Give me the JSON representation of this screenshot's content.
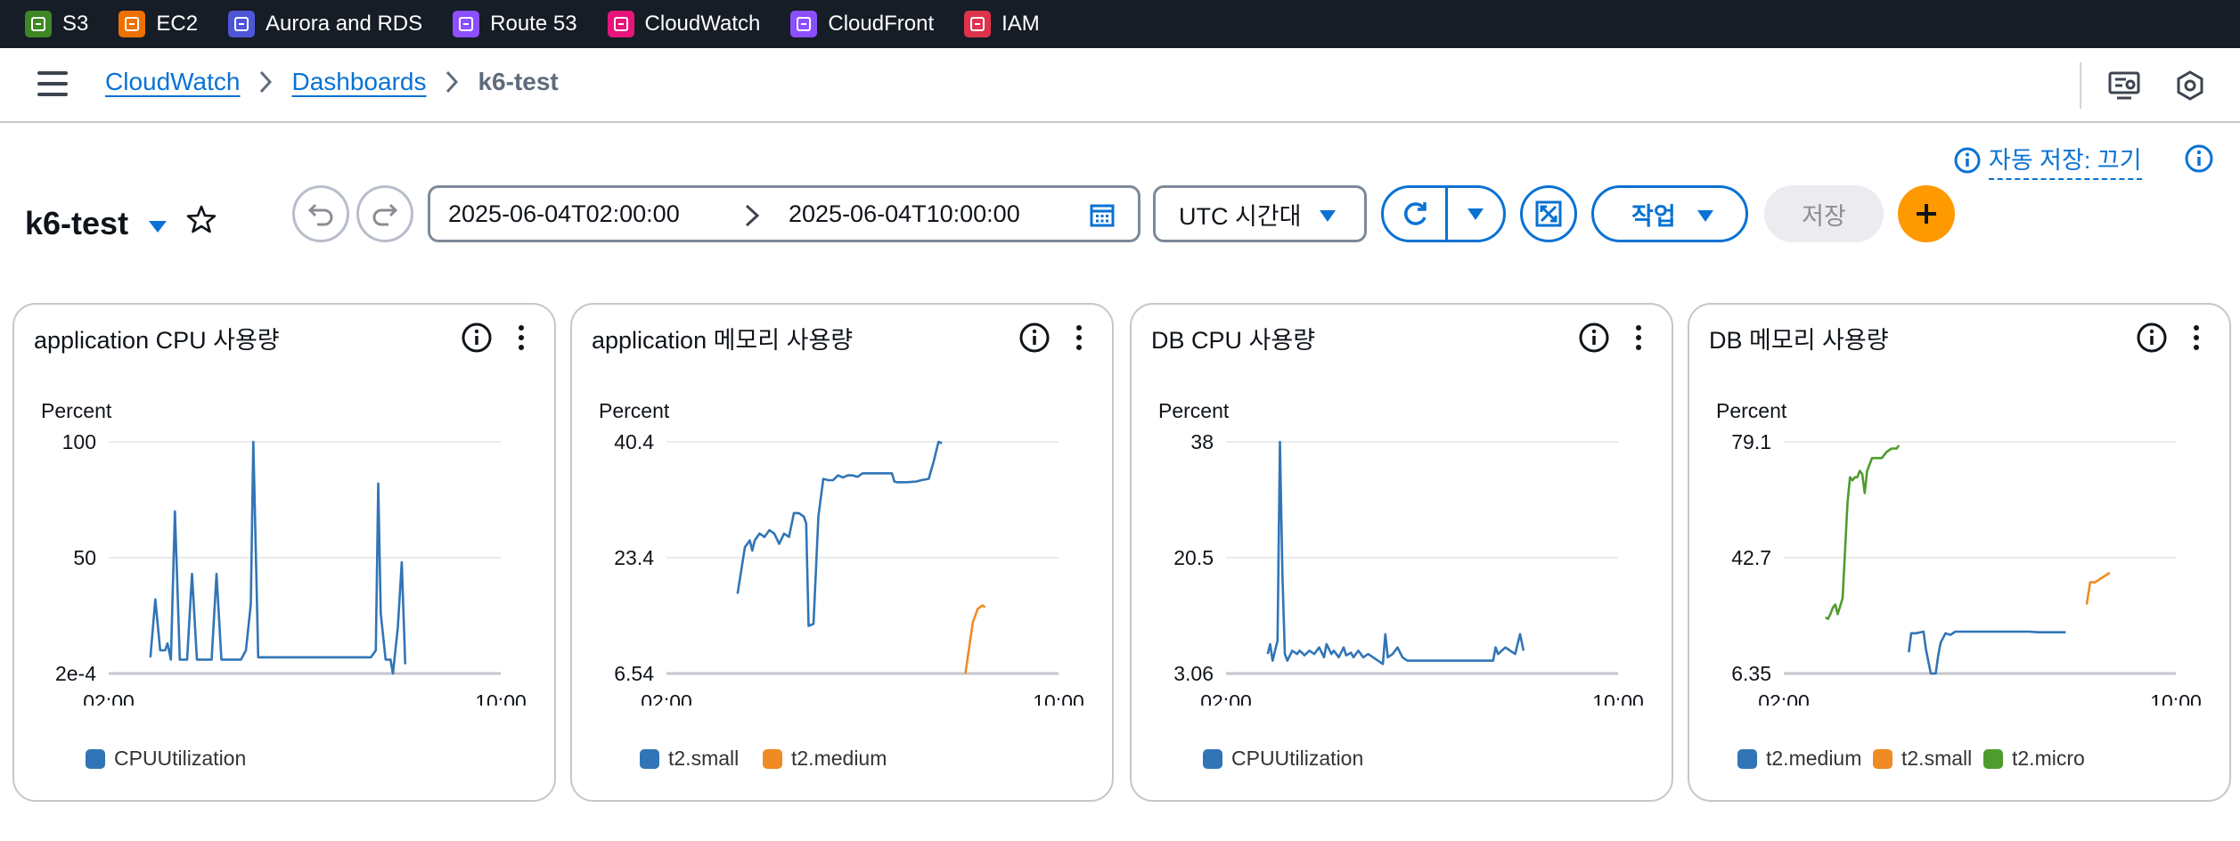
{
  "services": [
    {
      "label": "S3",
      "color": "#3f8624",
      "icon": "s3-icon"
    },
    {
      "label": "EC2",
      "color": "#ed7100",
      "icon": "ec2-icon"
    },
    {
      "label": "Aurora and RDS",
      "color": "#4d56d8",
      "icon": "rds-icon"
    },
    {
      "label": "Route 53",
      "color": "#8c4fff",
      "icon": "route53-icon"
    },
    {
      "label": "CloudWatch",
      "color": "#e7157b",
      "icon": "cloudwatch-icon"
    },
    {
      "label": "CloudFront",
      "color": "#8c4fff",
      "icon": "cloudfront-icon"
    },
    {
      "label": "IAM",
      "color": "#dd344c",
      "icon": "iam-icon"
    }
  ],
  "breadcrumb": {
    "root": "CloudWatch",
    "middle": "Dashboards",
    "current": "k6-test"
  },
  "autosave": {
    "label": "자동 저장: 끄기"
  },
  "dashboard": {
    "title": "k6-test",
    "start": "2025-06-04T02:00:00",
    "end": "2025-06-04T10:00:00",
    "timezone": "UTC 시간대",
    "actions_label": "작업",
    "save_label": "저장"
  },
  "colors": {
    "blue": "#3175b6",
    "orange": "#f08a24",
    "green": "#4e9c2e",
    "accent": "#0972d3"
  },
  "widgets": [
    {
      "title": "application CPU 사용량",
      "unit": "Percent",
      "chart_data": {
        "type": "line",
        "xlim": [
          "02:00",
          "10:00"
        ],
        "ylim": [
          0.0002,
          100
        ],
        "yticks": [
          "100",
          "50",
          "2e-4"
        ],
        "xticks": [
          "02:00",
          "10:00"
        ],
        "series": [
          {
            "name": "CPUUtilization",
            "color": "#3175b6",
            "points": [
              [
                0.85,
                7
              ],
              [
                0.95,
                32
              ],
              [
                1.05,
                10
              ],
              [
                1.15,
                10
              ],
              [
                1.2,
                13
              ],
              [
                1.27,
                6
              ],
              [
                1.35,
                70
              ],
              [
                1.45,
                6
              ],
              [
                1.5,
                6
              ],
              [
                1.6,
                6
              ],
              [
                1.7,
                43
              ],
              [
                1.8,
                6
              ],
              [
                1.9,
                6
              ],
              [
                2.0,
                6
              ],
              [
                2.1,
                6
              ],
              [
                2.2,
                43
              ],
              [
                2.3,
                6
              ],
              [
                2.5,
                6
              ],
              [
                2.7,
                6
              ],
              [
                2.8,
                10
              ],
              [
                2.9,
                30
              ],
              [
                2.95,
                100
              ],
              [
                3.05,
                7
              ],
              [
                3.1,
                7
              ],
              [
                3.5,
                7
              ],
              [
                4.0,
                7
              ],
              [
                4.5,
                7
              ],
              [
                5.0,
                7
              ],
              [
                5.35,
                7
              ],
              [
                5.45,
                10
              ],
              [
                5.5,
                82
              ],
              [
                5.55,
                26
              ],
              [
                5.65,
                6
              ],
              [
                5.75,
                6
              ],
              [
                5.8,
                0
              ],
              [
                5.9,
                20
              ],
              [
                5.98,
                48
              ],
              [
                6.05,
                4
              ]
            ]
          }
        ]
      }
    },
    {
      "title": "application 메모리 사용량",
      "unit": "Percent",
      "chart_data": {
        "type": "line",
        "xlim": [
          "02:00",
          "10:00"
        ],
        "ylim": [
          6.54,
          40.4
        ],
        "yticks": [
          "40.4",
          "23.4",
          "6.54"
        ],
        "xticks": [
          "02:00",
          "10:00"
        ],
        "series": [
          {
            "name": "t2.small",
            "color": "#3175b6",
            "points": [
              [
                1.45,
                18.2
              ],
              [
                1.6,
                25
              ],
              [
                1.7,
                26
              ],
              [
                1.75,
                24.5
              ],
              [
                1.8,
                26
              ],
              [
                1.9,
                27
              ],
              [
                2.0,
                26.5
              ],
              [
                2.1,
                27.5
              ],
              [
                2.2,
                27
              ],
              [
                2.3,
                25.5
              ],
              [
                2.4,
                27
              ],
              [
                2.5,
                26.5
              ],
              [
                2.6,
                30
              ],
              [
                2.7,
                30
              ],
              [
                2.8,
                29.5
              ],
              [
                2.85,
                28.5
              ],
              [
                2.9,
                13.5
              ],
              [
                3.0,
                13.8
              ],
              [
                3.1,
                29.5
              ],
              [
                3.2,
                35
              ],
              [
                3.3,
                34.8
              ],
              [
                3.4,
                34.8
              ],
              [
                3.5,
                35.5
              ],
              [
                3.6,
                35.2
              ],
              [
                3.7,
                35.5
              ],
              [
                3.8,
                35.5
              ],
              [
                3.9,
                35.3
              ],
              [
                4.0,
                35.8
              ],
              [
                4.1,
                35.8
              ],
              [
                4.2,
                35.8
              ],
              [
                4.3,
                35.8
              ],
              [
                4.4,
                35.8
              ],
              [
                4.5,
                35.8
              ],
              [
                4.6,
                35.8
              ],
              [
                4.65,
                34.6
              ],
              [
                4.7,
                34.5
              ],
              [
                4.9,
                34.5
              ],
              [
                5.1,
                34.6
              ],
              [
                5.2,
                34.8
              ],
              [
                5.35,
                35
              ],
              [
                5.45,
                37.5
              ],
              [
                5.55,
                40.4
              ],
              [
                5.62,
                40.2
              ]
            ]
          },
          {
            "name": "t2.medium",
            "color": "#f08a24",
            "points": [
              [
                6.1,
                6.54
              ],
              [
                6.25,
                14
              ],
              [
                6.35,
                16
              ],
              [
                6.45,
                16.5
              ],
              [
                6.5,
                16.2
              ]
            ]
          }
        ]
      }
    },
    {
      "title": "DB CPU 사용량",
      "unit": "Percent",
      "chart_data": {
        "type": "line",
        "xlim": [
          "02:00",
          "10:00"
        ],
        "ylim": [
          3.06,
          38
        ],
        "yticks": [
          "38",
          "20.5",
          "3.06"
        ],
        "xticks": [
          "02:00",
          "10:00"
        ],
        "series": [
          {
            "name": "CPUUtilization",
            "color": "#3175b6",
            "points": [
              [
                0.85,
                6
              ],
              [
                0.9,
                7.5
              ],
              [
                0.95,
                5
              ],
              [
                1.0,
                6.5
              ],
              [
                1.05,
                8
              ],
              [
                1.1,
                38
              ],
              [
                1.15,
                18
              ],
              [
                1.2,
                6
              ],
              [
                1.25,
                5
              ],
              [
                1.35,
                6.5
              ],
              [
                1.45,
                6
              ],
              [
                1.5,
                6.5
              ],
              [
                1.55,
                6.2
              ],
              [
                1.6,
                5.8
              ],
              [
                1.7,
                6.5
              ],
              [
                1.8,
                6
              ],
              [
                1.9,
                7
              ],
              [
                2.0,
                5.5
              ],
              [
                2.05,
                7.5
              ],
              [
                2.15,
                6
              ],
              [
                2.2,
                6.5
              ],
              [
                2.3,
                5.5
              ],
              [
                2.4,
                7
              ],
              [
                2.45,
                5.8
              ],
              [
                2.55,
                6.2
              ],
              [
                2.6,
                5.5
              ],
              [
                2.7,
                6.5
              ],
              [
                2.8,
                5.5
              ],
              [
                2.9,
                6
              ],
              [
                3.0,
                5.5
              ],
              [
                3.1,
                5
              ],
              [
                3.2,
                4.5
              ],
              [
                3.25,
                9
              ],
              [
                3.3,
                5.5
              ],
              [
                3.4,
                6
              ],
              [
                3.5,
                7
              ],
              [
                3.6,
                5.5
              ],
              [
                3.7,
                5
              ],
              [
                3.8,
                5
              ],
              [
                4.0,
                5
              ],
              [
                4.5,
                5
              ],
              [
                5.0,
                5
              ],
              [
                5.3,
                5
              ],
              [
                5.45,
                5
              ],
              [
                5.5,
                7
              ],
              [
                5.55,
                6
              ],
              [
                5.7,
                7
              ],
              [
                5.8,
                6.5
              ],
              [
                5.9,
                6
              ],
              [
                6.0,
                9
              ],
              [
                6.07,
                6.5
              ]
            ]
          }
        ]
      }
    },
    {
      "title": "DB 메모리 사용량",
      "unit": "Percent",
      "chart_data": {
        "type": "line",
        "xlim": [
          "02:00",
          "10:00"
        ],
        "ylim": [
          6.35,
          79.1
        ],
        "yticks": [
          "79.1",
          "42.7",
          "6.35"
        ],
        "xticks": [
          "02:00",
          "10:00"
        ],
        "series": [
          {
            "name": "t2.medium",
            "color": "#3175b6",
            "points": [
              [
                2.55,
                13
              ],
              [
                2.6,
                19
              ],
              [
                2.7,
                19
              ],
              [
                2.85,
                19.5
              ],
              [
                2.9,
                14
              ],
              [
                3.0,
                6.35
              ],
              [
                3.1,
                6.35
              ],
              [
                3.15,
                12
              ],
              [
                3.2,
                16
              ],
              [
                3.3,
                19
              ],
              [
                3.4,
                18.5
              ],
              [
                3.5,
                19.5
              ],
              [
                3.6,
                19.5
              ],
              [
                3.8,
                19.5
              ],
              [
                4.0,
                19.5
              ],
              [
                4.2,
                19.5
              ],
              [
                4.4,
                19.5
              ],
              [
                4.6,
                19.5
              ],
              [
                4.8,
                19.5
              ],
              [
                5.0,
                19.5
              ],
              [
                5.2,
                19.3
              ],
              [
                5.4,
                19.3
              ],
              [
                5.6,
                19.3
              ],
              [
                5.75,
                19.3
              ]
            ]
          },
          {
            "name": "t2.small",
            "color": "#f08a24",
            "points": [
              [
                6.18,
                28
              ],
              [
                6.25,
                35
              ],
              [
                6.35,
                35
              ],
              [
                6.45,
                36
              ],
              [
                6.55,
                37
              ],
              [
                6.65,
                38
              ]
            ]
          },
          {
            "name": "t2.micro",
            "color": "#4e9c2e",
            "points": [
              [
                0.85,
                24
              ],
              [
                0.9,
                23.5
              ],
              [
                0.95,
                25
              ],
              [
                1.0,
                27
              ],
              [
                1.05,
                28
              ],
              [
                1.1,
                25
              ],
              [
                1.2,
                30
              ],
              [
                1.3,
                60
              ],
              [
                1.35,
                68
              ],
              [
                1.4,
                67
              ],
              [
                1.45,
                68
              ],
              [
                1.5,
                68
              ],
              [
                1.55,
                70
              ],
              [
                1.6,
                69
              ],
              [
                1.65,
                63
              ],
              [
                1.7,
                70
              ],
              [
                1.8,
                74
              ],
              [
                1.9,
                74
              ],
              [
                2.0,
                74
              ],
              [
                2.1,
                76
              ],
              [
                2.2,
                77
              ],
              [
                2.3,
                77
              ],
              [
                2.35,
                78
              ]
            ]
          }
        ]
      }
    }
  ]
}
